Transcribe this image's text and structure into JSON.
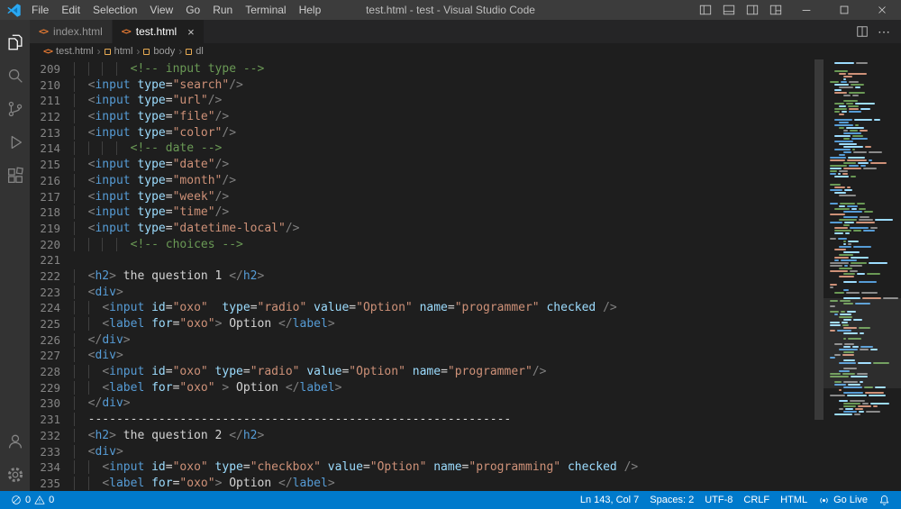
{
  "colors": {
    "accent": "#007acc",
    "titlebar": "#3c3c3c",
    "activitybar": "#333333",
    "editor_bg": "#1e1e1e",
    "tag": "#569cd6",
    "attribute": "#9cdcfe",
    "string": "#ce9178",
    "comment": "#6a9955",
    "punctuation": "#808080"
  },
  "icons": {
    "html_file": "<>",
    "close": "×",
    "more": "⋯",
    "chevron": "›"
  },
  "title_bar": {
    "title": "test.html - test - Visual Studio Code",
    "menu_items": [
      "File",
      "Edit",
      "Selection",
      "View",
      "Go",
      "Run",
      "Terminal",
      "Help"
    ]
  },
  "activity_bar": {
    "items": [
      "explorer",
      "search",
      "source-control",
      "run-and-debug",
      "extensions"
    ],
    "bottom": [
      "accounts",
      "manage"
    ]
  },
  "tabs": [
    {
      "label": "index.html",
      "active": false
    },
    {
      "label": "test.html",
      "active": true
    }
  ],
  "breadcrumb": [
    "test.html",
    "html",
    "body",
    "dl"
  ],
  "editor": {
    "lines": [
      {
        "num": "209",
        "tokens": [
          [
            "in",
            "        "
          ],
          [
            "cm",
            "<!-- input type -->"
          ]
        ]
      },
      {
        "num": "210",
        "tokens": [
          [
            "in",
            "  "
          ],
          [
            "pu",
            "<"
          ],
          [
            "tg",
            "input"
          ],
          [
            "at",
            " type"
          ],
          [
            "eq",
            "="
          ],
          [
            "st",
            "\"search\""
          ],
          [
            "pu",
            "/>"
          ]
        ]
      },
      {
        "num": "211",
        "tokens": [
          [
            "in",
            "  "
          ],
          [
            "pu",
            "<"
          ],
          [
            "tg",
            "input"
          ],
          [
            "at",
            " type"
          ],
          [
            "eq",
            "="
          ],
          [
            "st",
            "\"url\""
          ],
          [
            "pu",
            "/>"
          ]
        ]
      },
      {
        "num": "212",
        "tokens": [
          [
            "in",
            "  "
          ],
          [
            "pu",
            "<"
          ],
          [
            "tg",
            "input"
          ],
          [
            "at",
            " type"
          ],
          [
            "eq",
            "="
          ],
          [
            "st",
            "\"file\""
          ],
          [
            "pu",
            "/>"
          ]
        ]
      },
      {
        "num": "213",
        "tokens": [
          [
            "in",
            "  "
          ],
          [
            "pu",
            "<"
          ],
          [
            "tg",
            "input"
          ],
          [
            "at",
            " type"
          ],
          [
            "eq",
            "="
          ],
          [
            "st",
            "\"color\""
          ],
          [
            "pu",
            "/>"
          ]
        ]
      },
      {
        "num": "214",
        "tokens": [
          [
            "in",
            "        "
          ],
          [
            "cm",
            "<!-- date -->"
          ]
        ]
      },
      {
        "num": "215",
        "tokens": [
          [
            "in",
            "  "
          ],
          [
            "pu",
            "<"
          ],
          [
            "tg",
            "input"
          ],
          [
            "at",
            " type"
          ],
          [
            "eq",
            "="
          ],
          [
            "st",
            "\"date\""
          ],
          [
            "pu",
            "/>"
          ]
        ]
      },
      {
        "num": "216",
        "tokens": [
          [
            "in",
            "  "
          ],
          [
            "pu",
            "<"
          ],
          [
            "tg",
            "input"
          ],
          [
            "at",
            " type"
          ],
          [
            "eq",
            "="
          ],
          [
            "st",
            "\"month\""
          ],
          [
            "pu",
            "/>"
          ]
        ]
      },
      {
        "num": "217",
        "tokens": [
          [
            "in",
            "  "
          ],
          [
            "pu",
            "<"
          ],
          [
            "tg",
            "input"
          ],
          [
            "at",
            " type"
          ],
          [
            "eq",
            "="
          ],
          [
            "st",
            "\"week\""
          ],
          [
            "pu",
            "/>"
          ]
        ]
      },
      {
        "num": "218",
        "tokens": [
          [
            "in",
            "  "
          ],
          [
            "pu",
            "<"
          ],
          [
            "tg",
            "input"
          ],
          [
            "at",
            " type"
          ],
          [
            "eq",
            "="
          ],
          [
            "st",
            "\"time\""
          ],
          [
            "pu",
            "/>"
          ]
        ]
      },
      {
        "num": "219",
        "tokens": [
          [
            "in",
            "  "
          ],
          [
            "pu",
            "<"
          ],
          [
            "tg",
            "input"
          ],
          [
            "at",
            " type"
          ],
          [
            "eq",
            "="
          ],
          [
            "st",
            "\"datetime-local\""
          ],
          [
            "pu",
            "/>"
          ]
        ]
      },
      {
        "num": "220",
        "tokens": [
          [
            "in",
            "        "
          ],
          [
            "cm",
            "<!-- choices -->"
          ]
        ]
      },
      {
        "num": "221",
        "tokens": []
      },
      {
        "num": "222",
        "tokens": [
          [
            "in",
            "  "
          ],
          [
            "pu",
            "<"
          ],
          [
            "tg",
            "h2"
          ],
          [
            "pu",
            ">"
          ],
          [
            "tx",
            " the question 1 "
          ],
          [
            "pu",
            "</"
          ],
          [
            "tg",
            "h2"
          ],
          [
            "pu",
            ">"
          ]
        ]
      },
      {
        "num": "223",
        "tokens": [
          [
            "in",
            "  "
          ],
          [
            "pu",
            "<"
          ],
          [
            "tg",
            "div"
          ],
          [
            "pu",
            ">"
          ]
        ]
      },
      {
        "num": "224",
        "tokens": [
          [
            "in",
            "    "
          ],
          [
            "pu",
            "<"
          ],
          [
            "tg",
            "input"
          ],
          [
            "at",
            " id"
          ],
          [
            "eq",
            "="
          ],
          [
            "st",
            "\"oxo\""
          ],
          [
            "at",
            "  type"
          ],
          [
            "eq",
            "="
          ],
          [
            "st",
            "\"radio\""
          ],
          [
            "at",
            " value"
          ],
          [
            "eq",
            "="
          ],
          [
            "st",
            "\"Option\""
          ],
          [
            "at",
            " name"
          ],
          [
            "eq",
            "="
          ],
          [
            "st",
            "\"programmer\""
          ],
          [
            "at",
            " checked"
          ],
          [
            "tx",
            " "
          ],
          [
            "pu",
            "/>"
          ]
        ]
      },
      {
        "num": "225",
        "tokens": [
          [
            "in",
            "    "
          ],
          [
            "pu",
            "<"
          ],
          [
            "tg",
            "label"
          ],
          [
            "at",
            " for"
          ],
          [
            "eq",
            "="
          ],
          [
            "st",
            "\"oxo\""
          ],
          [
            "pu",
            ">"
          ],
          [
            "tx",
            " Option "
          ],
          [
            "pu",
            "</"
          ],
          [
            "tg",
            "label"
          ],
          [
            "pu",
            ">"
          ]
        ]
      },
      {
        "num": "226",
        "tokens": [
          [
            "in",
            "  "
          ],
          [
            "pu",
            "</"
          ],
          [
            "tg",
            "div"
          ],
          [
            "pu",
            ">"
          ]
        ]
      },
      {
        "num": "227",
        "tokens": [
          [
            "in",
            "  "
          ],
          [
            "pu",
            "<"
          ],
          [
            "tg",
            "div"
          ],
          [
            "pu",
            ">"
          ]
        ]
      },
      {
        "num": "228",
        "tokens": [
          [
            "in",
            "    "
          ],
          [
            "pu",
            "<"
          ],
          [
            "tg",
            "input"
          ],
          [
            "at",
            " id"
          ],
          [
            "eq",
            "="
          ],
          [
            "st",
            "\"oxo\""
          ],
          [
            "at",
            " type"
          ],
          [
            "eq",
            "="
          ],
          [
            "st",
            "\"radio\""
          ],
          [
            "at",
            " value"
          ],
          [
            "eq",
            "="
          ],
          [
            "st",
            "\"Option\""
          ],
          [
            "at",
            " name"
          ],
          [
            "eq",
            "="
          ],
          [
            "st",
            "\"programmer\""
          ],
          [
            "pu",
            "/>"
          ]
        ]
      },
      {
        "num": "229",
        "tokens": [
          [
            "in",
            "    "
          ],
          [
            "pu",
            "<"
          ],
          [
            "tg",
            "label"
          ],
          [
            "at",
            " for"
          ],
          [
            "eq",
            "="
          ],
          [
            "st",
            "\"oxo\""
          ],
          [
            "tx",
            " "
          ],
          [
            "pu",
            ">"
          ],
          [
            "tx",
            " Option "
          ],
          [
            "pu",
            "</"
          ],
          [
            "tg",
            "label"
          ],
          [
            "pu",
            ">"
          ]
        ]
      },
      {
        "num": "230",
        "tokens": [
          [
            "in",
            "  "
          ],
          [
            "pu",
            "</"
          ],
          [
            "tg",
            "div"
          ],
          [
            "pu",
            ">"
          ]
        ]
      },
      {
        "num": "231",
        "tokens": [
          [
            "in",
            "  "
          ],
          [
            "tx",
            "------------------------------------------------------------"
          ]
        ]
      },
      {
        "num": "232",
        "tokens": [
          [
            "in",
            "  "
          ],
          [
            "pu",
            "<"
          ],
          [
            "tg",
            "h2"
          ],
          [
            "pu",
            ">"
          ],
          [
            "tx",
            " the question 2 "
          ],
          [
            "pu",
            "</"
          ],
          [
            "tg",
            "h2"
          ],
          [
            "pu",
            ">"
          ]
        ]
      },
      {
        "num": "233",
        "tokens": [
          [
            "in",
            "  "
          ],
          [
            "pu",
            "<"
          ],
          [
            "tg",
            "div"
          ],
          [
            "pu",
            ">"
          ]
        ]
      },
      {
        "num": "234",
        "tokens": [
          [
            "in",
            "    "
          ],
          [
            "pu",
            "<"
          ],
          [
            "tg",
            "input"
          ],
          [
            "at",
            " id"
          ],
          [
            "eq",
            "="
          ],
          [
            "st",
            "\"oxo\""
          ],
          [
            "at",
            " type"
          ],
          [
            "eq",
            "="
          ],
          [
            "st",
            "\"checkbox\""
          ],
          [
            "at",
            " value"
          ],
          [
            "eq",
            "="
          ],
          [
            "st",
            "\"Option\""
          ],
          [
            "at",
            " name"
          ],
          [
            "eq",
            "="
          ],
          [
            "st",
            "\"programming\""
          ],
          [
            "at",
            " checked"
          ],
          [
            "tx",
            " "
          ],
          [
            "pu",
            "/>"
          ]
        ]
      },
      {
        "num": "235",
        "tokens": [
          [
            "in",
            "    "
          ],
          [
            "pu",
            "<"
          ],
          [
            "tg",
            "label"
          ],
          [
            "at",
            " for"
          ],
          [
            "eq",
            "="
          ],
          [
            "st",
            "\"oxo\""
          ],
          [
            "pu",
            ">"
          ],
          [
            "tx",
            " Option "
          ],
          [
            "pu",
            "</"
          ],
          [
            "tg",
            "label"
          ],
          [
            "pu",
            ">"
          ]
        ]
      }
    ]
  },
  "status_bar": {
    "errors": "0",
    "warnings": "0",
    "cursor": "Ln 143, Col 7",
    "indentation": "Spaces: 2",
    "encoding": "UTF-8",
    "eol": "CRLF",
    "language": "HTML",
    "go_live": "Go Live"
  }
}
